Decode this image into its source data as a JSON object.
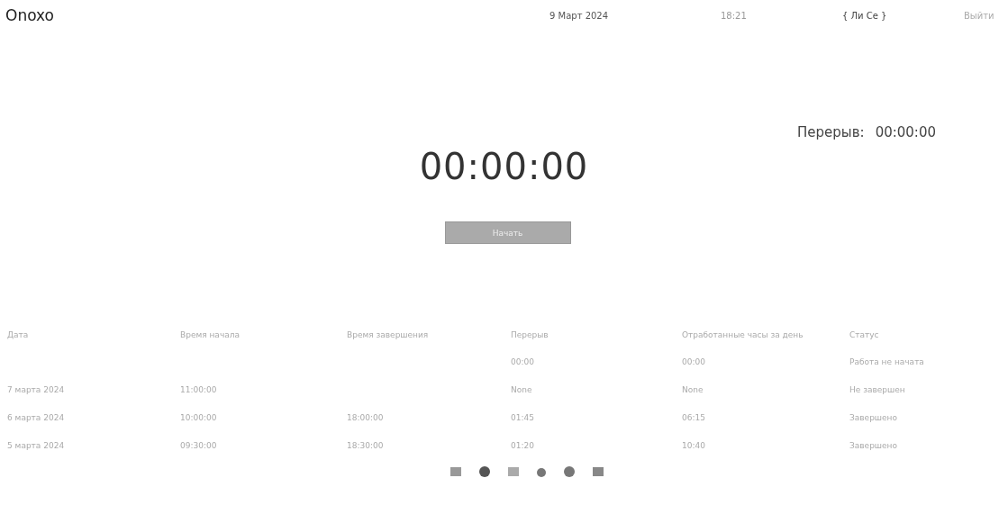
{
  "header": {
    "logo": "Onoxo",
    "date": "9 Март 2024",
    "time": "18:21",
    "user": "{ Ли Се }",
    "logout": "Выйти"
  },
  "break": {
    "label": "Перерыв:",
    "value": "00:00:00"
  },
  "timer": "00:00:00",
  "start_button": "Начать",
  "table": {
    "columns": [
      "Дата",
      "Время начала",
      "Время завершения",
      "Перерыв",
      "Отработанные часы за день",
      "Статус"
    ],
    "rows": [
      [
        "",
        "",
        "",
        "00:00",
        "00:00",
        "Работа не начата"
      ],
      [
        "7 марта 2024",
        "11:00:00",
        "",
        "None",
        "None",
        "Не завершен"
      ],
      [
        "6 марта 2024",
        "10:00:00",
        "18:00:00",
        "01:45",
        "06:15",
        "Завершено"
      ],
      [
        "5 марта 2024",
        "09:30:00",
        "18:30:00",
        "01:20",
        "10:40",
        "Завершено"
      ]
    ]
  }
}
